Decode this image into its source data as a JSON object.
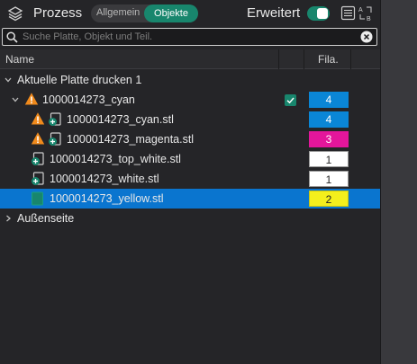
{
  "header": {
    "title": "Prozess",
    "tabs": [
      {
        "label": "Allgemein",
        "active": false
      },
      {
        "label": "Objekte",
        "active": true
      }
    ],
    "advanced_label": "Erweitert",
    "advanced_enabled": true,
    "icons": [
      "layers-icon",
      "table-icon",
      "sort-ab-icon"
    ]
  },
  "search": {
    "placeholder": "Suche Platte, Objekt und Teil.",
    "value": ""
  },
  "columns": {
    "name": "Name",
    "filament": "Fila."
  },
  "tree": {
    "plate": {
      "label": "Aktuelle Platte drucken 1",
      "expanded": true
    },
    "object": {
      "label": "1000014273_cyan",
      "warning": true,
      "checked": true,
      "filament": "4",
      "filament_color": "#0a86d6",
      "expanded": true
    },
    "parts": [
      {
        "label": "1000014273_cyan.stl",
        "warning": true,
        "filament": "4",
        "filament_color": "#0a86d6",
        "selected": false
      },
      {
        "label": "1000014273_magenta.stl",
        "warning": true,
        "filament": "3",
        "filament_color": "#e3169b",
        "selected": false
      },
      {
        "label": "1000014273_top_white.stl",
        "warning": false,
        "filament": "1",
        "filament_color": "#ffffff",
        "selected": false
      },
      {
        "label": "1000014273_white.stl",
        "warning": false,
        "filament": "1",
        "filament_color": "#ffffff",
        "selected": false
      },
      {
        "label": "1000014273_yellow.stl",
        "warning": false,
        "filament": "2",
        "filament_color": "#f4ef1c",
        "selected": true
      }
    ],
    "outside": {
      "label": "Außenseite",
      "expanded": false
    }
  },
  "colors": {
    "accent": "#18866d",
    "selection": "#0a75cf",
    "warning": "#f08a1c"
  }
}
